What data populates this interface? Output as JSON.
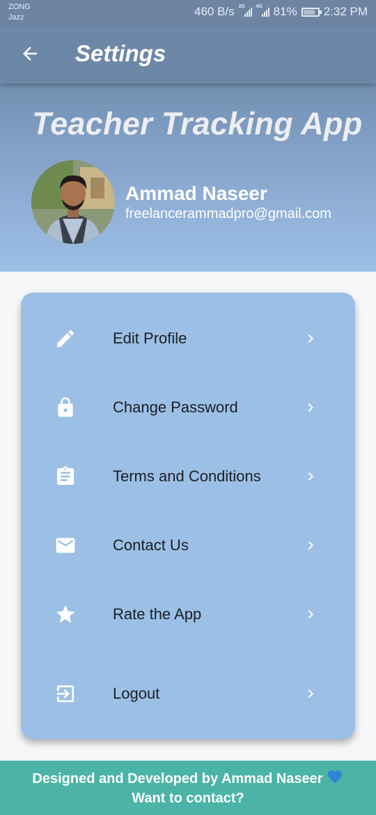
{
  "status_bar": {
    "carrier_line1": "ZONG",
    "carrier_line2": "Jazz",
    "speed": "460 B/s",
    "signal1_tag": "2G",
    "signal2_tag": "4G",
    "battery": "81%",
    "battery_level": 0.81,
    "time": "2:32 PM"
  },
  "app_bar": {
    "title": "Settings",
    "back_icon": "arrow-left-icon"
  },
  "header": {
    "app_title": "Teacher Tracking App",
    "user_name": "Ammad Naseer",
    "user_email": "freelancerammadpro@gmail.com"
  },
  "menu": {
    "items": [
      {
        "label": "Edit Profile",
        "icon": "pencil-icon"
      },
      {
        "label": "Change Password",
        "icon": "lock-icon"
      },
      {
        "label": "Terms and Conditions",
        "icon": "clipboard-icon"
      },
      {
        "label": "Contact Us",
        "icon": "envelope-icon"
      },
      {
        "label": "Rate the App",
        "icon": "star-icon"
      },
      {
        "label": "Logout",
        "icon": "logout-icon"
      }
    ]
  },
  "footer": {
    "line1": "Designed and Developed by Ammad Naseer",
    "line2": "Want to contact?"
  },
  "colors": {
    "app_bar": "#6d87a7",
    "card": "#9cbfe5",
    "footer": "#4bb4a6",
    "heart": "#2f86d8"
  }
}
